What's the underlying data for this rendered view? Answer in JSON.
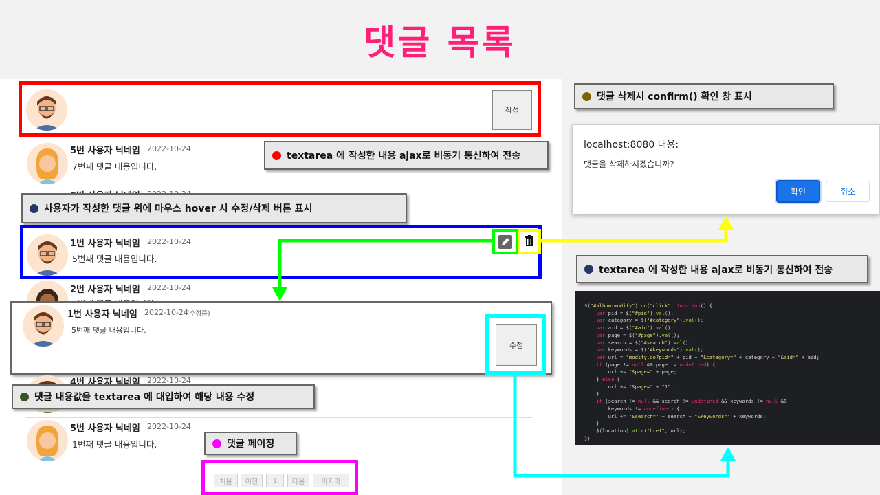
{
  "title": "댓글 목록",
  "write": {
    "button_label": "작성"
  },
  "comments": [
    {
      "name": "5번 사용자 닉네임",
      "date": "2022-10-24",
      "text": "7번째 댓글 내용입니다."
    },
    {
      "name": "6번 사용자 닉네임",
      "date": "2022-10-24"
    },
    {
      "name": "1번 사용자 닉네임",
      "date": "2022-10-24",
      "text": "5번째 댓글 내용입니다."
    },
    {
      "name": "2번 사용자 닉네임",
      "date": "2022-10-24",
      "text": "4번째 댓글 내용입니다."
    },
    {
      "name": "4번 사용자 닉네임",
      "date": "2022-10-24"
    },
    {
      "name": "5번 사용자 닉네임",
      "date": "2022-10-24",
      "text": "1번째 댓글 내용입니다."
    }
  ],
  "edit": {
    "name": "1번 사용자 닉네임",
    "date": "2022-10-24",
    "status": "(수정중)",
    "value": "5번째 댓글 내용입니다.",
    "button_label": "수정"
  },
  "callouts": {
    "ajax_left": "textarea 에 작성한 내용 ajax로 비동기 통신하여 전송",
    "hover": "사용자가 작성한 댓글 위에 마우스 hover 시 수정/삭제 버튼 표시",
    "edit": "댓글 내용값을 textarea 에 대입하여 해당 내용 수정",
    "paging": "댓글 페이징",
    "confirm": "댓글 삭제시 confirm() 확인 창 표시",
    "ajax_right": "textarea 에 작성한 내용 ajax로 비동기 통신하여 전송"
  },
  "dialog": {
    "title": "localhost:8080 내용:",
    "message": "댓글을 삭제하시겠습니까?",
    "ok_label": "확인",
    "cancel_label": "취소"
  },
  "pagination": [
    "처음",
    "이전",
    "1",
    "다음",
    "마지막"
  ],
  "code_lines": [
    "$(\"#album-modify\").on(\"click\", function() {",
    "    var pid = $(\"#pid\").val();",
    "    var category = $(\"#category\").val();",
    "    var aid = $(\"#aid\").val();",
    "    var page = $(\"#page\").val();",
    "    var search = $(\"#search\").val();",
    "    var keywords = $(\"#keywords\").val();",
    "    var url = \"modify.do?pid=\" + pid + \"&category=\" + category + \"&aid=\" + aid;",
    "    if (page != null && page != undefined) {",
    "        url += \"&page=\" + page;",
    "    } else {",
    "        url += \"&page=\" + \"1\";",
    "    }",
    "    if (search != null && search != undefined && keywords != null &&",
    "        keywords != undefined) {",
    "        url += \"&search=\" + search + \"&keywords=\" + keywords;",
    "    }",
    "    $(location).attr(\"href\", url);",
    "})"
  ],
  "colors": {
    "title": "#ff1f78",
    "red_frame": "#ff0000",
    "blue_frame": "#0000ff",
    "green_arrow": "#00ff00",
    "yellow_arrow": "#ffff00",
    "cyan_frame": "#00ffff",
    "magenta_frame": "#ff00ff",
    "dialog_ok": "#1a73e8"
  },
  "icons": {
    "edit": "pencil-icon",
    "delete": "trash-icon"
  }
}
